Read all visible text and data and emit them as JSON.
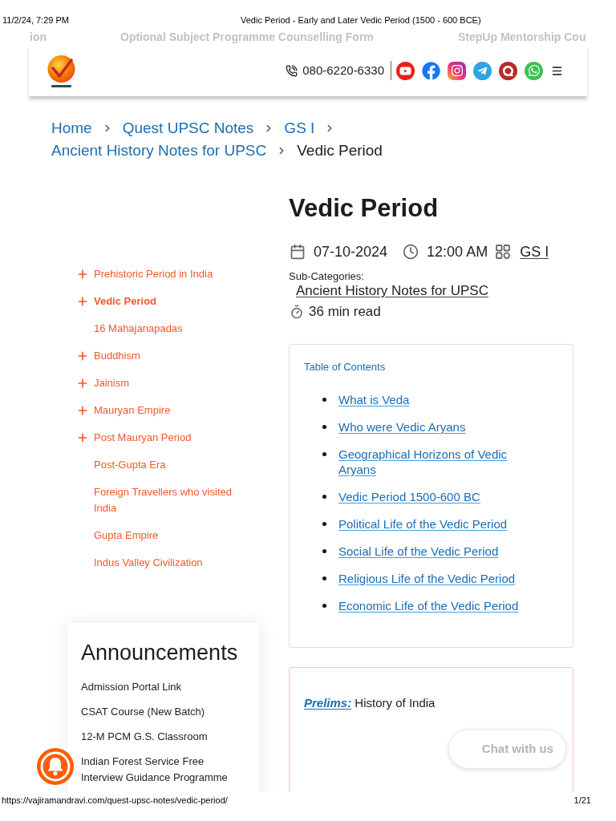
{
  "print_header": {
    "date": "11/2/24, 7:29 PM",
    "title": "Vedic Period - Early and Later Vedic Period (1500 - 600 BCE)"
  },
  "top_links": [
    "ion",
    "Optional Subject Programme Counselling Form",
    "StepUp Mentorship Cou"
  ],
  "header": {
    "phone": "080-6220-6330"
  },
  "breadcrumb": [
    {
      "label": "Home",
      "current": false
    },
    {
      "label": "Quest UPSC Notes",
      "current": false
    },
    {
      "label": "GS I",
      "current": false
    },
    {
      "label": "Ancient History Notes for UPSC",
      "current": false
    },
    {
      "label": "Vedic Period",
      "current": true
    }
  ],
  "article": {
    "title": "Vedic Period",
    "date": "07-10-2024",
    "time": "12:00 AM",
    "category": "GS I",
    "subcategories_label": "Sub-Categories:",
    "subcategory": "Ancient History Notes for UPSC",
    "read_time": "36 min read"
  },
  "sidebar": {
    "items": [
      {
        "label": "Prehistoric Period in India",
        "expandable": true,
        "selected": false
      },
      {
        "label": "Vedic Period",
        "expandable": true,
        "selected": true
      },
      {
        "label": "16 Mahajanapadas",
        "expandable": false,
        "selected": false
      },
      {
        "label": "Buddhism",
        "expandable": true,
        "selected": false
      },
      {
        "label": "Jainism",
        "expandable": true,
        "selected": false
      },
      {
        "label": "Mauryan Empire",
        "expandable": true,
        "selected": false
      },
      {
        "label": "Post Mauryan Period",
        "expandable": true,
        "selected": false
      },
      {
        "label": "Post-Gupta Era",
        "expandable": false,
        "selected": false
      },
      {
        "label": "Foreign Travellers who visited India",
        "expandable": false,
        "selected": false
      },
      {
        "label": "Gupta Empire",
        "expandable": false,
        "selected": false
      },
      {
        "label": "Indus Valley Civilization",
        "expandable": false,
        "selected": false
      }
    ]
  },
  "toc": {
    "title": "Table of Contents",
    "items": [
      "What is Veda",
      "Who were Vedic Aryans",
      "Geographical Horizons of Vedic Aryans",
      "Vedic Period 1500-600 BC",
      "Political Life of the Vedic Period",
      "Social Life of the Vedic Period",
      "Religious Life of the Vedic Period",
      "Economic Life of the Vedic Period"
    ]
  },
  "announcements": {
    "title": "Announcements",
    "items": [
      "Admission Portal Link",
      "CSAT Course (New Batch)",
      "12-M PCM G.S. Classroom",
      "Indian Forest Service Free Interview Guidance Programme"
    ]
  },
  "prelims": {
    "label": "Prelims:",
    "text": "History of India"
  },
  "chat_button": "Chat with us",
  "footer": {
    "url": "https://vajiramandravi.com/quest-upsc-notes/vedic-period/",
    "page": "1/21"
  }
}
